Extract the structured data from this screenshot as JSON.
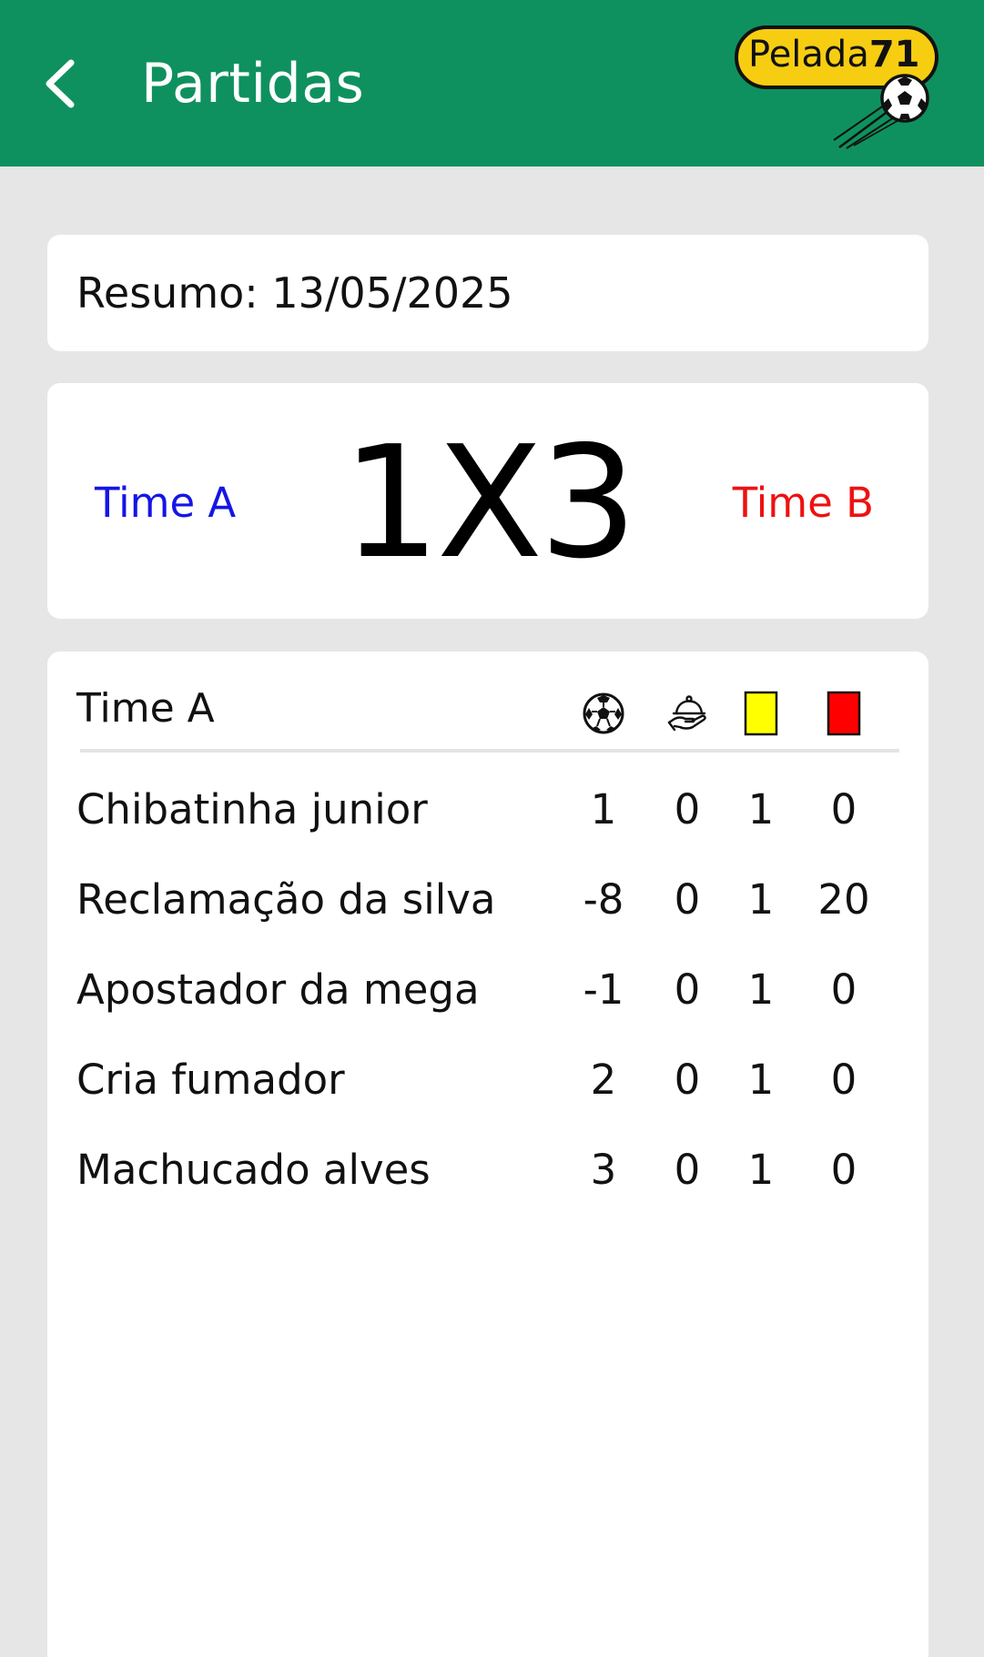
{
  "header": {
    "title": "Partidas",
    "back_icon": "chevron-left-icon",
    "logo": {
      "text_main": "Pelada",
      "text_number": "71",
      "icon": "soccer-ball-icon"
    },
    "bg_color": "#0e915f"
  },
  "summary": {
    "date_label": "Resumo: 13/05/2025"
  },
  "scoreboard": {
    "team_a": "Time A",
    "team_b": "Time B",
    "score": "1X3",
    "team_a_color": "#1515e6",
    "team_b_color": "#ee1111"
  },
  "stats": {
    "team": "Time A",
    "columns": [
      {
        "icon": "soccer-ball-icon"
      },
      {
        "icon": "serving-hand-icon"
      },
      {
        "icon": "yellow-card-icon",
        "color": "#ffff00"
      },
      {
        "icon": "red-card-icon",
        "color": "#ff0000"
      }
    ],
    "rows": [
      {
        "name": "Chibatinha junior",
        "values": [
          "1",
          "0",
          "1",
          "0"
        ]
      },
      {
        "name": "Reclamação da silva",
        "values": [
          "-8",
          "0",
          "1",
          "20"
        ]
      },
      {
        "name": "Apostador da mega",
        "values": [
          "-1",
          "0",
          "1",
          "0"
        ]
      },
      {
        "name": "Cria fumador",
        "values": [
          "2",
          "0",
          "1",
          "0"
        ]
      },
      {
        "name": "Machucado alves",
        "values": [
          "3",
          "0",
          "1",
          "0"
        ]
      }
    ]
  }
}
